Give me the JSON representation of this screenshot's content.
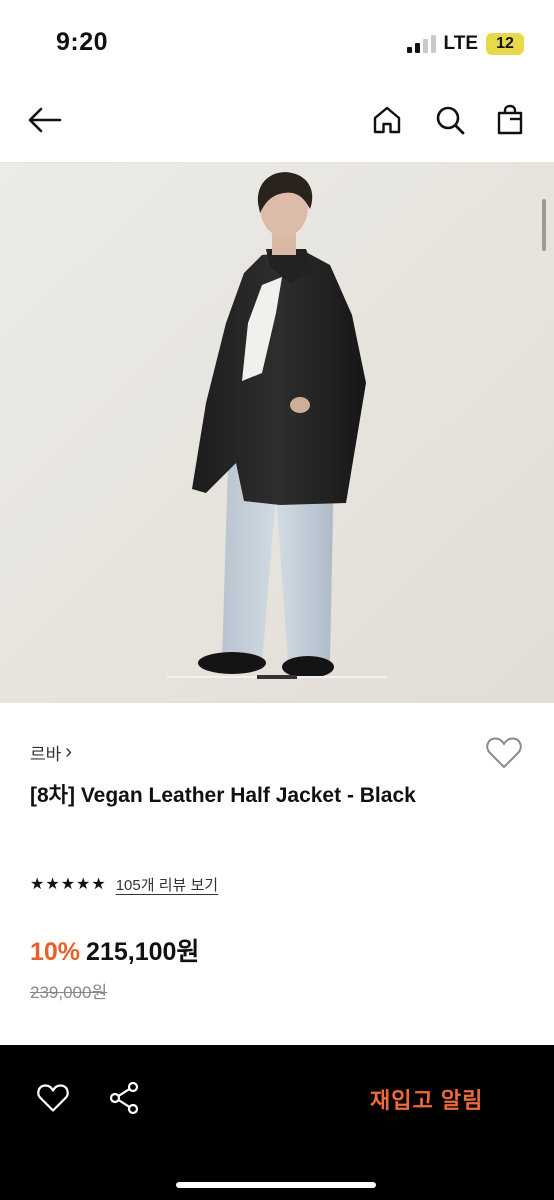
{
  "status_bar": {
    "time": "9:20",
    "network": "LTE",
    "battery": "12"
  },
  "nav": {
    "icons": [
      "arrow-left-icon",
      "home-icon",
      "search-icon",
      "shopping-bag-icon"
    ]
  },
  "product_image": {
    "carousel_position": 0.5
  },
  "product": {
    "brand": "르바",
    "brand_chevron": "›",
    "title": "[8차] Vegan Leather Half Jacket - Black",
    "rating_stars": 5,
    "review_link": "105개 리뷰 보기",
    "discount": "10%",
    "price": "215,100원",
    "original_price": "239,000원"
  },
  "bottom_bar": {
    "restock_label": "재입고 알림",
    "icons": [
      "heart-icon",
      "share-icon"
    ]
  },
  "colors": {
    "accent": "#e8612c",
    "restock": "#ef6a3a",
    "bottom_bar_bg": "#000000",
    "image_bg": "#e9e6e1"
  }
}
